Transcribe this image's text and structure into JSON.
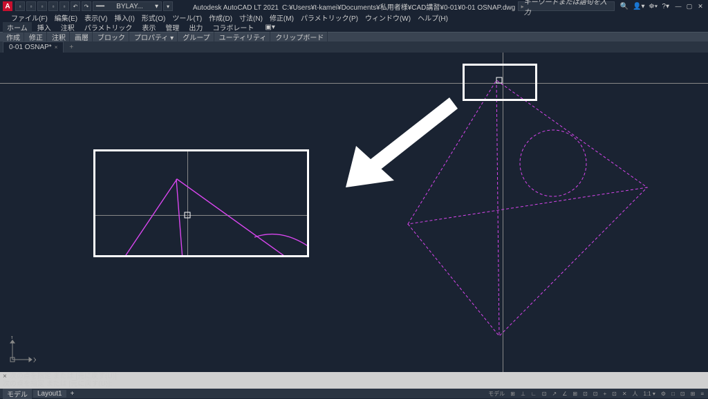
{
  "app": {
    "title": "Autodesk AutoCAD LT 2021",
    "filepath": "C:¥Users¥t-kamei¥Documents¥私用者様¥CAD講習¥0-01¥0-01 OSNAP.dwg",
    "search_placeholder": "キーワードまたは語句を入力"
  },
  "layer_selector": "BYLAY...",
  "menubar": [
    "ファイル(F)",
    "編集(E)",
    "表示(V)",
    "挿入(I)",
    "形式(O)",
    "ツール(T)",
    "作成(D)",
    "寸法(N)",
    "修正(M)",
    "パラメトリック(P)",
    "ウィンドウ(W)",
    "ヘルプ(H)"
  ],
  "ribbon_tabs": [
    "ホーム",
    "挿入",
    "注釈",
    "パラメトリック",
    "表示",
    "管理",
    "出力",
    "コラボレート"
  ],
  "panels": [
    "作成",
    "修正",
    "注釈",
    "画層",
    "ブロック",
    "プロパティ ▾",
    "グループ",
    "ユーティリティ",
    "クリップボード"
  ],
  "doc_tab": {
    "name": "0-01 OSNAP*",
    "modified": true
  },
  "ucs": {
    "x": "X",
    "y": "Y"
  },
  "cmdline": {
    "hist1": "次の点を指定 または [元に戻す(U)]:",
    "hist2": "次の点を指定 または [元に戻す(U)]:",
    "prompt": "›_",
    "value": "z",
    "handle": "×"
  },
  "status": {
    "tabs": [
      "モデル",
      "Layout1"
    ],
    "right": [
      "モデル",
      "⊞",
      "⊥",
      "∟",
      "⊡",
      "↗",
      "∠",
      "⊞",
      "⊡",
      "⊡",
      "+",
      "⊡",
      "✕",
      "人",
      "1:1 ▾",
      "⚙",
      "□",
      "⊡",
      "⊞",
      "≡"
    ]
  },
  "qat_icons": [
    "📁",
    "📂",
    "💾",
    "⎌",
    "↻",
    "🖨",
    "↶",
    "↷"
  ],
  "title_icons": [
    "🔍",
    "👤",
    "⛯",
    "▾",
    "?",
    "▾"
  ]
}
